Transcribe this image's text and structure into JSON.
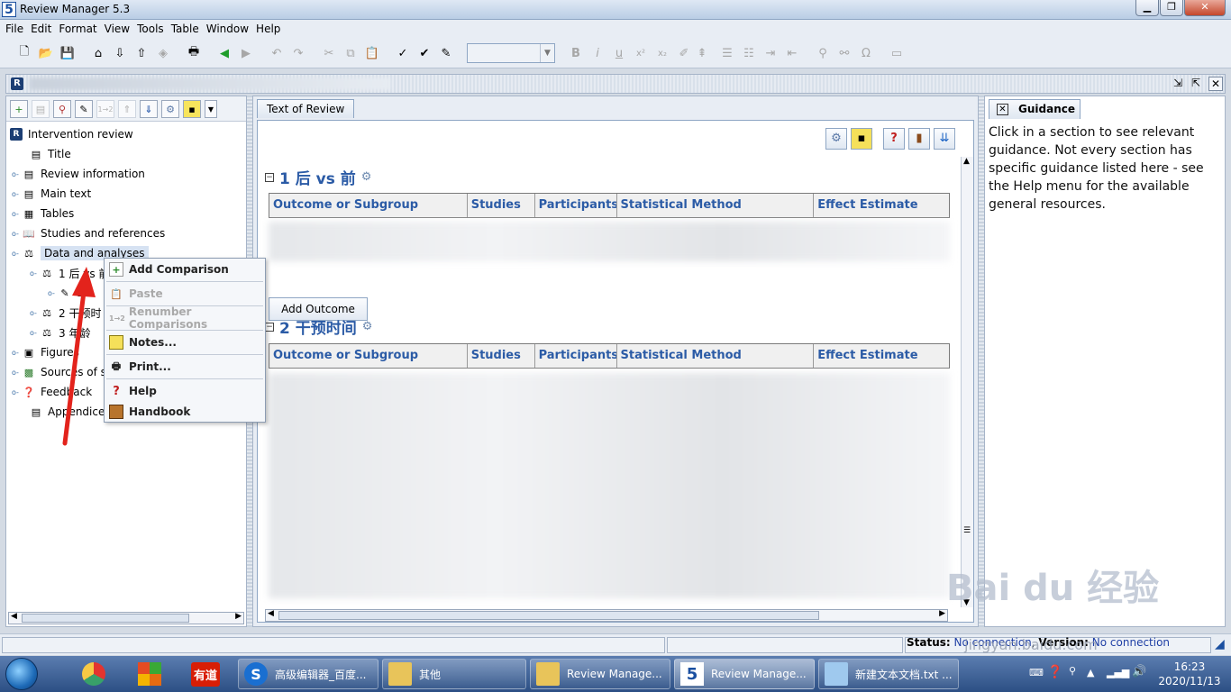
{
  "window": {
    "title": "Review Manager 5.3",
    "app_icon": "5"
  },
  "menubar": [
    "File",
    "Edit",
    "Format",
    "View",
    "Tools",
    "Table",
    "Window",
    "Help"
  ],
  "tree": {
    "nodes": [
      {
        "label": "Intervention review",
        "icon": "review-icon"
      },
      {
        "label": "Title",
        "icon": "doc-icon"
      },
      {
        "label": "Review information",
        "icon": "doc-icon"
      },
      {
        "label": "Main text",
        "icon": "doc-icon"
      },
      {
        "label": "Tables",
        "icon": "table-icon"
      },
      {
        "label": "Studies and references",
        "icon": "book-icon"
      },
      {
        "label": "Data and analyses",
        "icon": "analysis-icon"
      },
      {
        "label": "1 后 vs 前",
        "icon": "scale-icon"
      },
      {
        "label": "1 i",
        "icon": "pencil-icon"
      },
      {
        "label": "2 干预时",
        "icon": "scale-icon"
      },
      {
        "label": "3 年龄",
        "icon": "scale-icon"
      },
      {
        "label": "Figures",
        "icon": "image-icon"
      },
      {
        "label": "Sources of s",
        "icon": "sources-icon"
      },
      {
        "label": "Feedback",
        "icon": "feedback-icon"
      },
      {
        "label": "Appendices",
        "icon": "doc-icon"
      }
    ]
  },
  "context_menu": {
    "items": [
      {
        "label": "Add Comparison",
        "enabled": true
      },
      {
        "label": "Paste",
        "enabled": false
      },
      {
        "label": "Renumber Comparisons",
        "enabled": false
      },
      {
        "label": "Notes...",
        "enabled": true
      },
      {
        "label": "Print...",
        "enabled": true
      },
      {
        "label": "Help",
        "enabled": true
      },
      {
        "label": "Handbook",
        "enabled": true
      }
    ],
    "renumber_prefix": "1→2"
  },
  "center": {
    "tab_label": "Text of Review",
    "sections": [
      {
        "title": "1 后 vs 前"
      },
      {
        "title": "2 干预时间"
      }
    ],
    "table_headers": [
      "Outcome or Subgroup",
      "Studies",
      "Participants",
      "Statistical Method",
      "Effect Estimate"
    ],
    "add_outcome_label": "Add Outcome"
  },
  "guidance": {
    "tab_label": "Guidance",
    "text": "Click in a section to see relevant guidance. Not every section has specific guidance listed here - see the Help menu for the available general resources."
  },
  "statusbar": {
    "status_label": "Status:",
    "status_value": "No connection",
    "version_label": "Version:",
    "version_value": "No connection"
  },
  "taskbar": {
    "pinned": [
      "有道"
    ],
    "tasks": [
      {
        "label": "高级编辑器_百度...",
        "icon": "sogou-icon"
      },
      {
        "label": "其他",
        "icon": "folder-icon"
      },
      {
        "label": "Review Manage...",
        "icon": "folder-icon"
      },
      {
        "label": "Review Manage...",
        "icon": "revman-icon"
      },
      {
        "label": "新建文本文档.txt ...",
        "icon": "notepad-icon"
      }
    ],
    "time": "16:23",
    "date": "2020/11/13"
  },
  "watermark": {
    "brand": "Bai du 经验",
    "url": "jingyan.baidu.com"
  }
}
